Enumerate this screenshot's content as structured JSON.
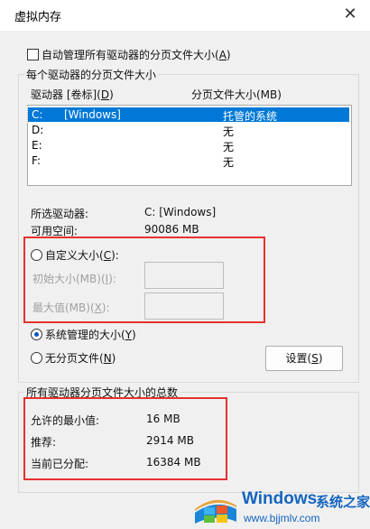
{
  "window": {
    "title": "虚拟内存",
    "close_label": "✕"
  },
  "auto_manage": {
    "label": "自动管理所有驱动器的分页文件大小(",
    "key": "A",
    "label_end": ")",
    "checked": false
  },
  "per_drive_group": {
    "label": "每个驱动器的分页文件大小",
    "col_drive": "驱动器 [卷标](",
    "col_drive_key": "D",
    "col_drive_end": ")",
    "col_size": "分页文件大小(MB)",
    "drives": [
      {
        "drive": "C:",
        "label": "[Windows]",
        "size": "托管的系统",
        "selected": true
      },
      {
        "drive": "D:",
        "label": "",
        "size": "无",
        "selected": false
      },
      {
        "drive": "E:",
        "label": "",
        "size": "无",
        "selected": false
      },
      {
        "drive": "F:",
        "label": "",
        "size": "无",
        "selected": false
      }
    ],
    "selected_drive_label": "所选驱动器:",
    "selected_drive_value": "C:  [Windows]",
    "free_space_label": "可用空间:",
    "free_space_value": "90086 MB",
    "custom_size": {
      "label": "自定义大小(",
      "key": "C",
      "label_end": "):",
      "selected": false
    },
    "initial_size": {
      "label": "初始大小(MB)(",
      "key": "I",
      "label_end": "):",
      "value": ""
    },
    "max_size": {
      "label": "最大值(MB)(",
      "key": "X",
      "label_end": "):",
      "value": ""
    },
    "system_managed": {
      "label": "系统管理的大小(",
      "key": "Y",
      "label_end": ")",
      "selected": true
    },
    "no_paging": {
      "label": "无分页文件(",
      "key": "N",
      "label_end": ")",
      "selected": false
    },
    "set_button": {
      "label": "设置(",
      "key": "S",
      "label_end": ")"
    }
  },
  "totals_group": {
    "label": "所有驱动器分页文件大小的总数",
    "min_allowed_label": "允许的最小值:",
    "min_allowed_value": "16 MB",
    "recommended_label": "推荐:",
    "recommended_value": "2914 MB",
    "current_label": "当前已分配:",
    "current_value": "16384 MB"
  },
  "watermark": {
    "brand": "Windows",
    "site_cn": "系统之家",
    "url": "www.bjjmlv.com"
  },
  "colors": {
    "highlight": "#0078d7",
    "annotation_red": "#e5322e",
    "radio_dot": "#0a58ca"
  }
}
